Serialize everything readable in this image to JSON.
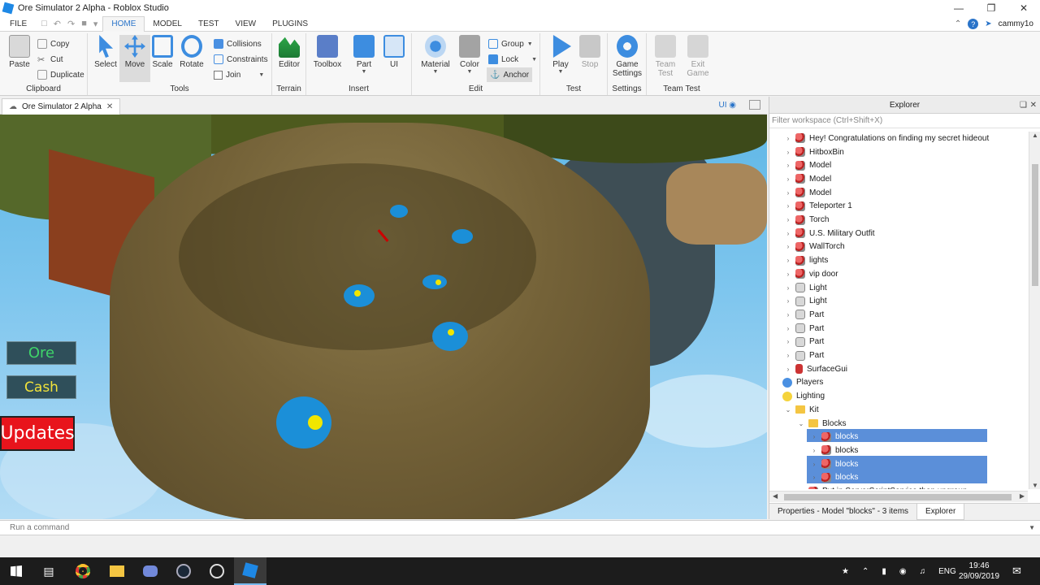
{
  "window": {
    "title": "Ore Simulator 2  Alpha - Roblox Studio"
  },
  "menu": {
    "file": "FILE",
    "tabs": [
      "HOME",
      "MODEL",
      "TEST",
      "VIEW",
      "PLUGINS"
    ],
    "user": "cammy1o"
  },
  "ribbon": {
    "clipboard": {
      "label": "Clipboard",
      "paste": "Paste",
      "copy": "Copy",
      "cut": "Cut",
      "duplicate": "Duplicate"
    },
    "tools": {
      "label": "Tools",
      "select": "Select",
      "move": "Move",
      "scale": "Scale",
      "rotate": "Rotate",
      "collisions": "Collisions",
      "constraints": "Constraints",
      "join": "Join"
    },
    "terrain": {
      "label": "Terrain",
      "editor": "Editor"
    },
    "insert": {
      "label": "Insert",
      "toolbox": "Toolbox",
      "part": "Part",
      "ui": "UI"
    },
    "edit": {
      "label": "Edit",
      "material": "Material",
      "color": "Color",
      "group": "Group",
      "lock": "Lock",
      "anchor": "Anchor"
    },
    "test": {
      "label": "Test",
      "play": "Play",
      "stop": "Stop"
    },
    "settings": {
      "label": "Settings",
      "game_settings_1": "Game",
      "game_settings_2": "Settings"
    },
    "team_test": {
      "label": "Team Test",
      "team_1": "Team",
      "team_2": "Test",
      "exit_1": "Exit",
      "exit_2": "Game"
    }
  },
  "doc_tab": {
    "label": "Ore Simulator 2 Alpha",
    "ui_toggle": "UI"
  },
  "game_gui": {
    "ore": "Ore",
    "cash": "Cash",
    "updates": "Updates"
  },
  "explorer": {
    "title": "Explorer",
    "filter_placeholder": "Filter workspace (Ctrl+Shift+X)",
    "items": [
      {
        "label": "Hey! Congratulations on finding my secret hideout",
        "icon": "model-icon"
      },
      {
        "label": "HitboxBin",
        "icon": "model-icon"
      },
      {
        "label": "Model",
        "icon": "model-icon"
      },
      {
        "label": "Model",
        "icon": "model-icon"
      },
      {
        "label": "Model",
        "icon": "model-icon"
      },
      {
        "label": "Teleporter 1",
        "icon": "model-icon"
      },
      {
        "label": "Torch",
        "icon": "model-icon"
      },
      {
        "label": "U.S. Military Outfit",
        "icon": "model-icon"
      },
      {
        "label": "WallTorch",
        "icon": "model-icon"
      },
      {
        "label": "lights",
        "icon": "model-icon"
      },
      {
        "label": "vip door",
        "icon": "model-icon"
      },
      {
        "label": "Light",
        "icon": "part-icon"
      },
      {
        "label": "Light",
        "icon": "part-icon"
      },
      {
        "label": "Part",
        "icon": "part-icon"
      },
      {
        "label": "Part",
        "icon": "part-icon"
      },
      {
        "label": "Part",
        "icon": "part-icon"
      },
      {
        "label": "Part",
        "icon": "part-icon"
      },
      {
        "label": "SurfaceGui",
        "icon": "surfacegui-icon"
      },
      {
        "label": "Players",
        "icon": "players-icon"
      },
      {
        "label": "Lighting",
        "icon": "lighting-icon"
      },
      {
        "label": "Kit",
        "icon": "folder-icon"
      },
      {
        "label": "Blocks",
        "icon": "folder-icon"
      },
      {
        "label": "blocks",
        "icon": "model-icon"
      },
      {
        "label": "blocks",
        "icon": "model-icon"
      },
      {
        "label": "blocks",
        "icon": "model-icon"
      },
      {
        "label": "blocks",
        "icon": "model-icon"
      },
      {
        "label": "Put in ServerScriptService then ungroup",
        "icon": "model-icon"
      }
    ],
    "bottom_tabs": {
      "properties": "Properties - Model \"blocks\" - 3 items",
      "explorer": "Explorer"
    }
  },
  "command_bar": {
    "placeholder": "Run a command"
  },
  "taskbar": {
    "time": "19:46",
    "date": "29/09/2019",
    "lang": "ENG"
  },
  "colors": {
    "accent": "#2a74c9",
    "selection": "#5b8fd9",
    "ore_button": "#2f4f5a",
    "ore_text": "#3fd46a",
    "updates_bg": "#e8141c"
  }
}
